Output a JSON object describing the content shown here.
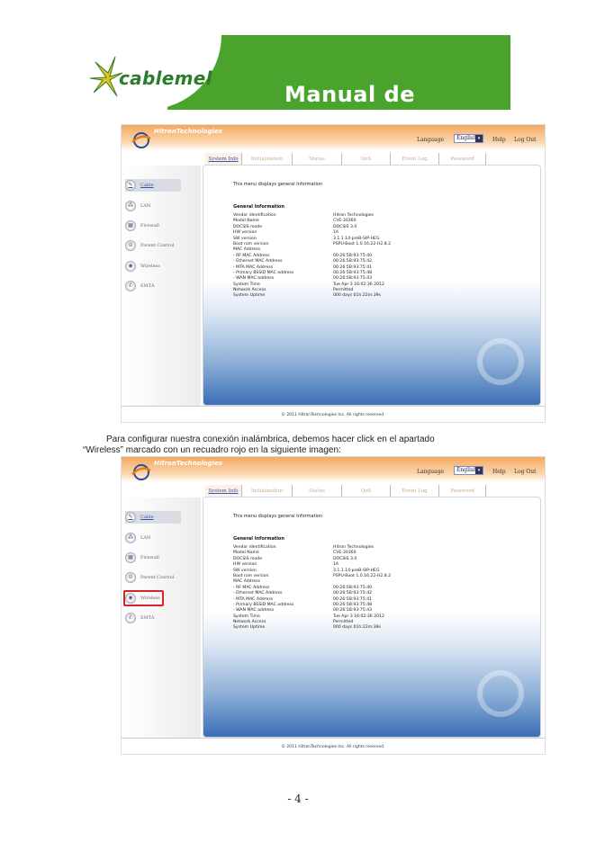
{
  "banner": {
    "logo_text": "cablemel",
    "title": "Manual de Usuario"
  },
  "router_ui": {
    "brand": "HitronTechnologies",
    "language_label": "Language",
    "language_value": "English",
    "help": "Help",
    "logout": "Log Out",
    "tabs": [
      "System Info",
      "Initialization",
      "Status",
      "QoS",
      "Event Log",
      "Password"
    ],
    "sidebar": [
      "Cable",
      "LAN",
      "Firewall",
      "Parent Control",
      "Wireless",
      "EMTA"
    ],
    "intro": "This menu displays general Information",
    "section_title": "General Information",
    "info_rows": [
      {
        "k": "Vendor identification",
        "v": "Hitron Technologies"
      },
      {
        "k": "Model Name",
        "v": "CVE-30360"
      },
      {
        "k": "DOCSIS mode",
        "v": "DOCSIS 3.0"
      },
      {
        "k": "HW version",
        "v": "1A"
      },
      {
        "k": "SW version",
        "v": "3.1.1.14-preB-SIP-HEG"
      },
      {
        "k": "Boot rom version",
        "v": "PSPU-Boot 1.0.16.22-H2.8.2"
      },
      {
        "k": "MAC Address",
        "v": ""
      },
      {
        "k": "- RF MAC Address",
        "v": "00:26:5B:93:75:40"
      },
      {
        "k": "- Ethernet MAC Address",
        "v": "00:26:5B:93:75:42"
      },
      {
        "k": "- MTA MAC Address",
        "v": "00:26:5B:93:75:41"
      },
      {
        "k": "- Primary BSSID MAC address",
        "v": "00:26:5B:93:75:48"
      },
      {
        "k": "- WAN MAC address",
        "v": "00:26:5B:93:75:43"
      },
      {
        "k": "System Time",
        "v": "Tue Apr 3 16:02:36 2012"
      },
      {
        "k": "Network Access",
        "v": "Permitted"
      },
      {
        "k": "System Uptime",
        "v": "000 days 01h:22m:39s"
      }
    ],
    "copyright": "© 2011 HitronTechnologies Inc.  All rights reserved."
  },
  "paragraph": {
    "line1": "Para configurar nuestra conexión inalámbrica, debemos hacer click en el apartado",
    "line2": "“Wireless” marcado con un recuadro rojo en la siguiente imagen:"
  },
  "page_number": "- 4 -",
  "colors": {
    "brand_green": "#4aa32d",
    "orange": "#f4a860",
    "highlight": "#d8232a"
  }
}
